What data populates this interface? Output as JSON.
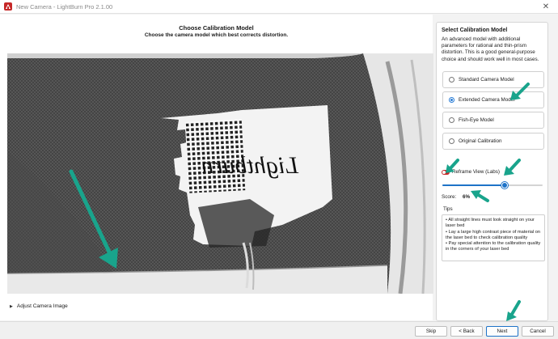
{
  "window": {
    "title": "New Camera - LightBurn Pro 2.1.00"
  },
  "header": {
    "title": "Choose Calibration Model",
    "subtitle": "Choose the camera model which best corrects distortion."
  },
  "preview": {
    "adjust_label": "Adjust Camera Image"
  },
  "side": {
    "title": "Select Calibration Model",
    "description": "An advanced model with additional parameters for rational and thin-prism distortion. This is a good general-purpose choice and should work well in most cases.",
    "options": [
      {
        "label": "Standard Camera Model",
        "selected": false
      },
      {
        "label": "Extended Camera Model",
        "selected": true
      },
      {
        "label": "Fish-Eye Model",
        "selected": false
      },
      {
        "label": "Original Calibration",
        "selected": false
      }
    ],
    "reframe_label": "Reframe View (Labs)",
    "reframe_slider_fraction": 0.62,
    "score_label": "Score:",
    "score_value": "6%",
    "tips_label": "Tips",
    "tips": [
      "• All straight lines must look straight on your laser bed",
      "• Lay a large high contrast piece of material on the laser bed to check calibration quality",
      "• Pay special attention to the calibration quality in the corners of your laser bed"
    ]
  },
  "footer": {
    "skip": "Skip",
    "back": "< Back",
    "next": "Next",
    "cancel": "Cancel"
  },
  "colors": {
    "accent": "#1e73c8",
    "annotation_arrow": "#19a48c",
    "toggle": "#c62828"
  }
}
